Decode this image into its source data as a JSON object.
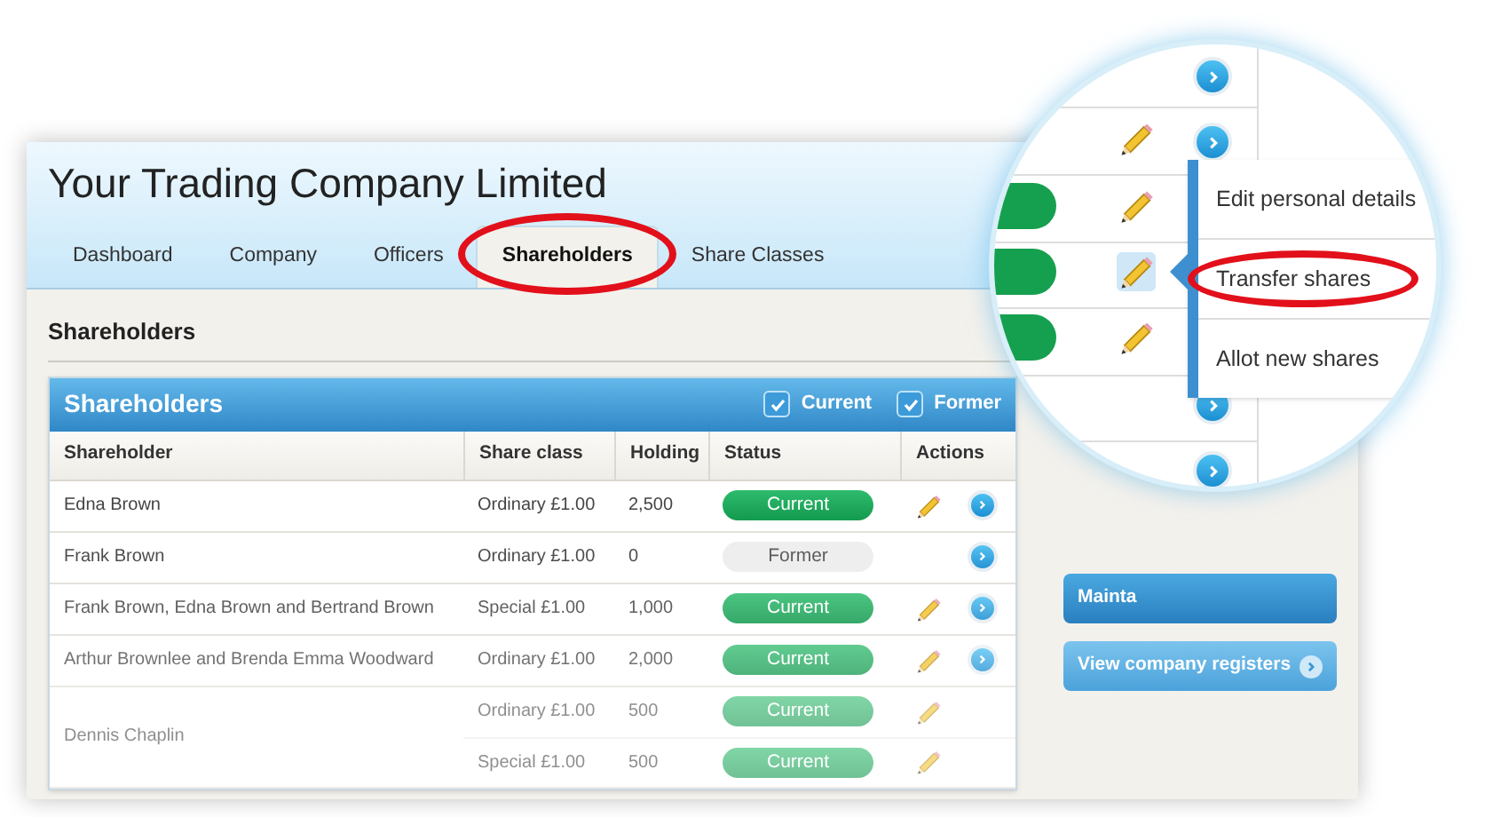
{
  "window": {
    "title": "Your Trading Company Limited"
  },
  "tabs": [
    {
      "label": "Dashboard",
      "selected": false,
      "circled": false
    },
    {
      "label": "Company",
      "selected": false,
      "circled": false
    },
    {
      "label": "Officers",
      "selected": false,
      "circled": false
    },
    {
      "label": "Shareholders",
      "selected": true,
      "circled": true
    },
    {
      "label": "Share Classes",
      "selected": false,
      "circled": false
    }
  ],
  "section_title": "Shareholders",
  "panel": {
    "title": "Shareholders",
    "filters": [
      {
        "label": "Current",
        "checked": true
      },
      {
        "label": "Former",
        "checked": true
      }
    ]
  },
  "table": {
    "columns": [
      "Shareholder",
      "Share class",
      "Holding",
      "Status",
      "Actions"
    ],
    "rows": [
      {
        "shareholder": "Edna Brown",
        "holdings": [
          {
            "share_class": "Ordinary £1.00",
            "holding": "2,500",
            "status": "Current",
            "kind": "current",
            "editable": true
          }
        ]
      },
      {
        "shareholder": "Frank Brown",
        "holdings": [
          {
            "share_class": "Ordinary £1.00",
            "holding": "0",
            "status": "Former",
            "kind": "former",
            "editable": false
          }
        ]
      },
      {
        "shareholder": "Frank Brown, Edna Brown and Bertrand Brown",
        "holdings": [
          {
            "share_class": "Special £1.00",
            "holding": "1,000",
            "status": "Current",
            "kind": "current",
            "editable": true
          }
        ]
      },
      {
        "shareholder": "Arthur Brownlee and Brenda Emma Woodward",
        "holdings": [
          {
            "share_class": "Ordinary £1.00",
            "holding": "2,000",
            "status": "Current",
            "kind": "current",
            "editable": true
          }
        ]
      },
      {
        "shareholder": "Dennis Chaplin",
        "holdings": [
          {
            "share_class": "Ordinary £1.00",
            "holding": "500",
            "status": "Current",
            "kind": "current",
            "editable": true
          },
          {
            "share_class": "Special £1.00",
            "holding": "500",
            "status": "Current",
            "kind": "current",
            "editable": true
          }
        ]
      }
    ]
  },
  "sidebar": {
    "buttons": [
      "Mainta",
      "View company registers"
    ]
  },
  "magnifier": {
    "menu": [
      {
        "label": "Edit personal details",
        "circled": false
      },
      {
        "label": "Transfer shares",
        "circled": true
      },
      {
        "label": "Allot new shares",
        "circled": false
      }
    ]
  }
}
